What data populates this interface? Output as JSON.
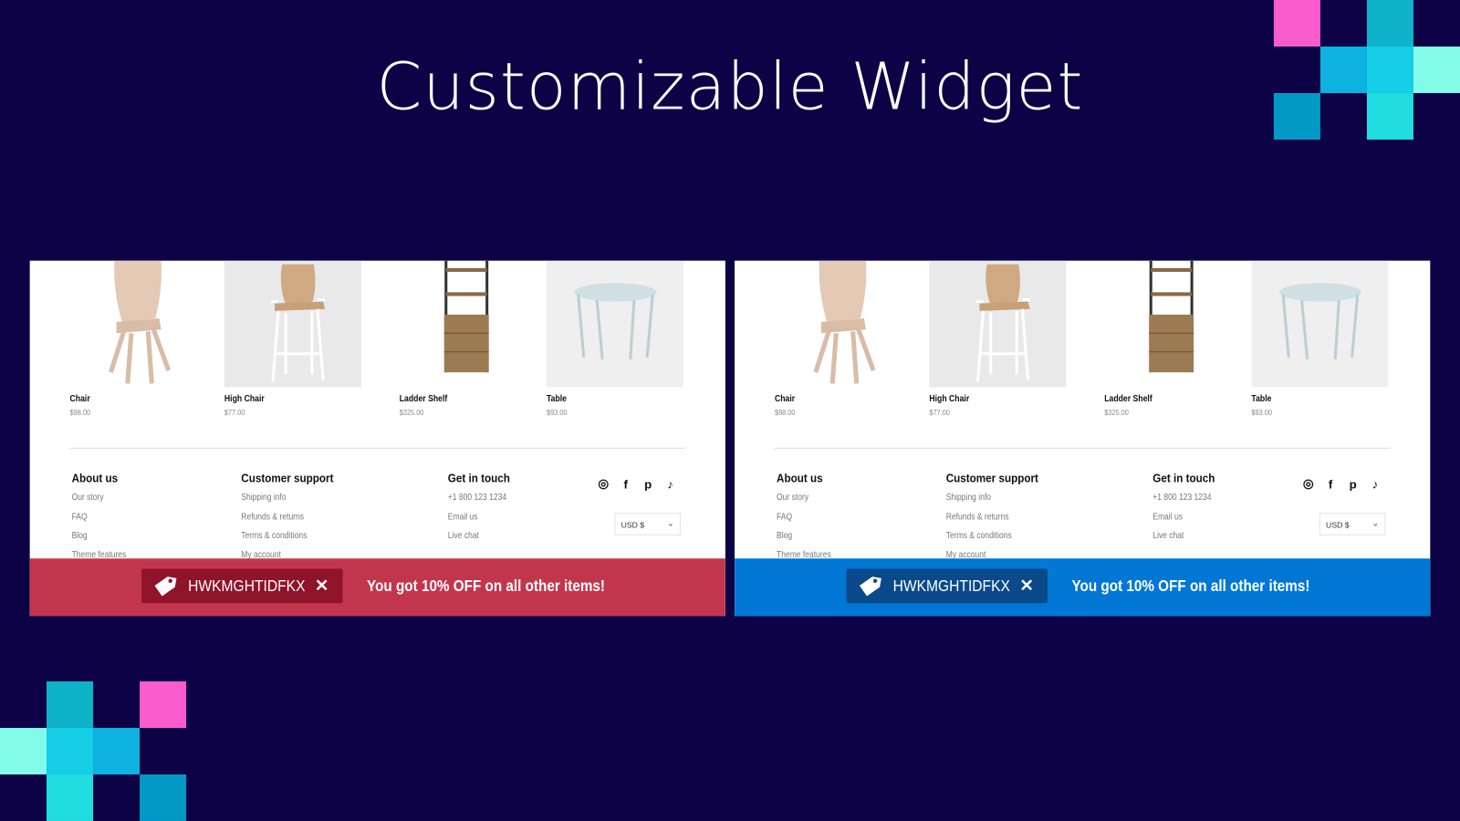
{
  "title": "Customizable Widget",
  "decor_colors": {
    "pink": "#fb5ccd",
    "teal": "#0fb3c9",
    "blue": "#0db2e0",
    "cyan": "#14cfe6",
    "mint": "#82fce8",
    "deep": "#0399c7",
    "aqua": "#20dde1"
  },
  "panels": [
    {
      "variant": "red",
      "banner_color": "#c2364d",
      "coupon_color": "#8f1329"
    },
    {
      "variant": "blue",
      "banner_color": "#0077d4",
      "coupon_color": "#0a4a8a"
    }
  ],
  "products": [
    {
      "name": "Chair",
      "price": "$98.00"
    },
    {
      "name": "High Chair",
      "price": "$77.00"
    },
    {
      "name": "Ladder Shelf",
      "price": "$325.00"
    },
    {
      "name": "Table",
      "price": "$93.00"
    }
  ],
  "footer": {
    "columns": [
      {
        "heading": "About us",
        "links": [
          "Our story",
          "FAQ",
          "Blog",
          "Theme features"
        ]
      },
      {
        "heading": "Customer support",
        "links": [
          "Shipping info",
          "Refunds & returns",
          "Terms & conditions",
          "My account"
        ]
      },
      {
        "heading": "Get in touch",
        "links": [
          "+1 800 123 1234",
          "Email us",
          "Live chat"
        ]
      }
    ],
    "socials": [
      "instagram-icon",
      "facebook-icon",
      "pinterest-icon",
      "tiktok-icon"
    ],
    "currency": "USD $"
  },
  "banner": {
    "coupon_code": "HWKMGHTIDFKX",
    "message": "You got 10% OFF on all other items!"
  }
}
